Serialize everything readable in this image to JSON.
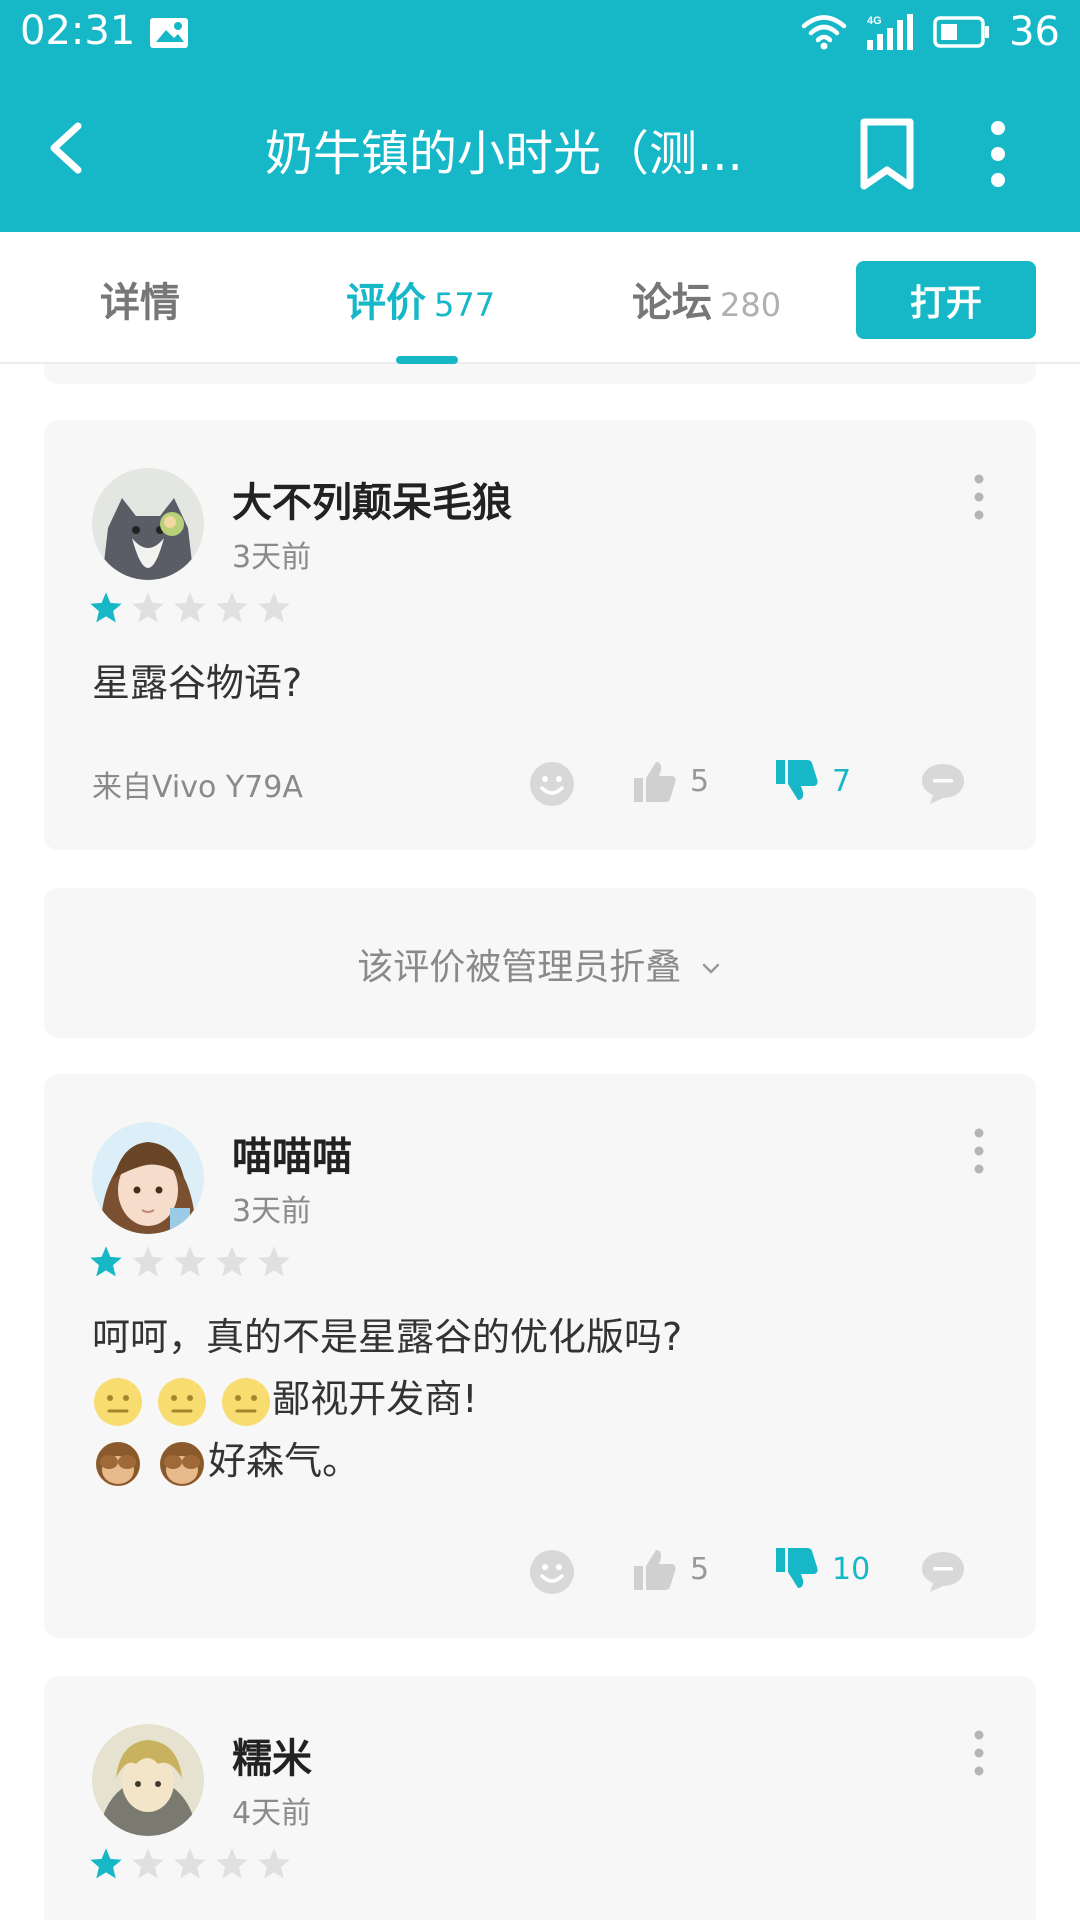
{
  "status_bar": {
    "time": "02:31",
    "network": "4G",
    "battery": "36"
  },
  "app_bar": {
    "title": "奶牛镇的小时光（测...",
    "icons": [
      "back-arrow-icon",
      "bookmark-icon",
      "more-vertical-icon"
    ]
  },
  "tabs": [
    {
      "label": "详情",
      "count": ""
    },
    {
      "label": "评价",
      "count": "577"
    },
    {
      "label": "论坛",
      "count": "280"
    }
  ],
  "open_button": "打开",
  "colors": {
    "accent": "#16b8c8",
    "card_bg": "#f7f7f7",
    "star_empty": "#e0e0e0"
  },
  "reviews": [
    {
      "username": "大不列颠呆毛狼",
      "time": "3天前",
      "rating": 1,
      "text": "星露谷物语?",
      "device": "来自Vivo Y79A",
      "likes": "5",
      "dislikes": "7"
    },
    {
      "collapsed_text": "该评价被管理员折叠"
    },
    {
      "username": "喵喵喵",
      "time": "3天前",
      "rating": 1,
      "line1": "呵呵，真的不是星露谷的优化版吗?",
      "line2": "鄙视开发商!",
      "line3": "好森气。",
      "likes": "5",
      "dislikes": "10"
    },
    {
      "username": "糯米",
      "time": "4天前",
      "rating": 1
    }
  ]
}
